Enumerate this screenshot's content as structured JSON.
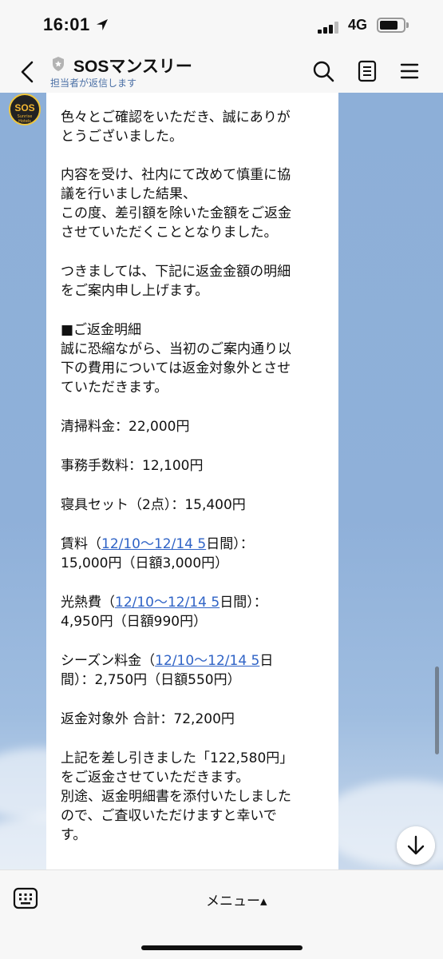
{
  "status_bar": {
    "time": "16:01",
    "network": "4G",
    "battery_level": 0.7
  },
  "header": {
    "title": "SOSマンスリー",
    "subtitle": "担当者が返信します"
  },
  "avatar": {
    "text": "SOS",
    "subtext": "Sunrise Hotels"
  },
  "message": {
    "lines": [
      [
        "色々とご確認をいただき、誠にありが"
      ],
      [
        "とうございました。"
      ],
      [
        "内容を受け、社内にて改めて慎重に協"
      ],
      [
        "議を行いました結果、"
      ],
      [
        "この度、差引額を除いた金額をご返金"
      ],
      [
        "させていただくこととなりました。"
      ],
      [
        "つきましては、下記に返金金額の明細"
      ],
      [
        "をご案内申し上げます。"
      ],
      [
        "■ご返金明細"
      ],
      [
        "誠に恐縮ながら、当初のご案内通り以"
      ],
      [
        "下の費用については返金対象外とさせ"
      ],
      [
        "ていただきます。"
      ],
      [
        "清掃料金：22,000円"
      ],
      [
        "事務手数料：12,100円"
      ],
      [
        "寝具セット（2点）：15,400円"
      ],
      [
        "賃料（",
        "12/10〜12/14 5",
        "日間）："
      ],
      [
        "15,000円（日額3,000円）"
      ],
      [
        "光熱費（",
        "12/10〜12/14 5",
        "日間）："
      ],
      [
        "4,950円（日額990円）"
      ],
      [
        "シーズン料金（",
        "12/10〜12/14 5",
        "日"
      ],
      [
        "間）：2,750円（日額550円）"
      ],
      [
        "返金対象外 合計：72,200円"
      ],
      [
        "上記を差し引きました「122,580円」"
      ],
      [
        "をご返金させていただきます。"
      ],
      [
        "別途、返金明細書を添付いたしました"
      ],
      [
        "ので、ご査収いただけますと幸いで"
      ],
      [
        "す。"
      ]
    ]
  },
  "bottom_bar": {
    "menu_label": "メニュー▴"
  },
  "colors": {
    "link": "#2f63c6",
    "chat_background": "#8fb0d9",
    "bubble": "#ffffff"
  }
}
